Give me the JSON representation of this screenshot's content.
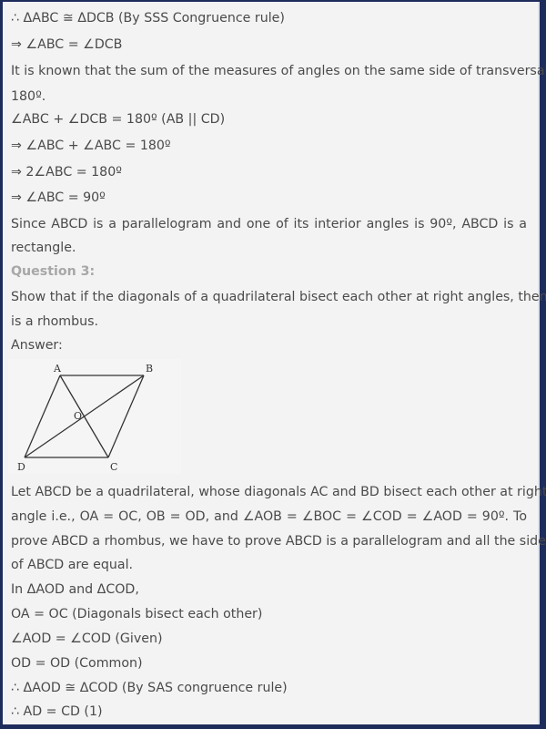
{
  "lines": [
    "∴ ΔABC ≅ ΔDCB (By SSS Congruence rule)",
    "⇒ ∠ABC = ∠DCB",
    "It is known that the sum of the measures of angles on the same side of transversal is",
    "180º.",
    "∠ABC + ∠DCB = 180º (AB || CD)",
    "⇒ ∠ABC + ∠ABC = 180º",
    "⇒ 2∠ABC = 180º",
    "⇒ ∠ABC = 90º",
    "Since ABCD is a parallelogram and one of its interior angles is 90º, ABCD is a",
    "rectangle.",
    "Question 3:",
    "Show that if the diagonals of a quadrilateral bisect each other at right angles, then it",
    "is a rhombus.",
    "Answer:",
    "Let ABCD be a quadrilateral, whose diagonals AC and BD bisect each other at right",
    "angle i.e., OA = OC, OB = OD, and ∠AOB = ∠BOC = ∠COD = ∠AOD = 90º. To",
    "prove ABCD a rhombus, we have to prove ABCD is a parallelogram and all the sides",
    "of ABCD are equal.",
    "In ΔAOD and ΔCOD,",
    "OA = OC (Diagonals bisect each other)",
    "∠AOD = ∠COD (Given)",
    "OD = OD (Common)",
    "∴ ΔAOD ≅ ΔCOD (By SAS congruence rule)",
    "∴ AD = CD (1)"
  ],
  "diagram": {
    "labels": {
      "A": "A",
      "B": "B",
      "C": "C",
      "D": "D",
      "O": "O"
    }
  },
  "colors": {
    "text": "#4a4a4a",
    "question": "#a7a7a7",
    "background": "#f3f3f3",
    "frame": "#1e2c5c"
  }
}
